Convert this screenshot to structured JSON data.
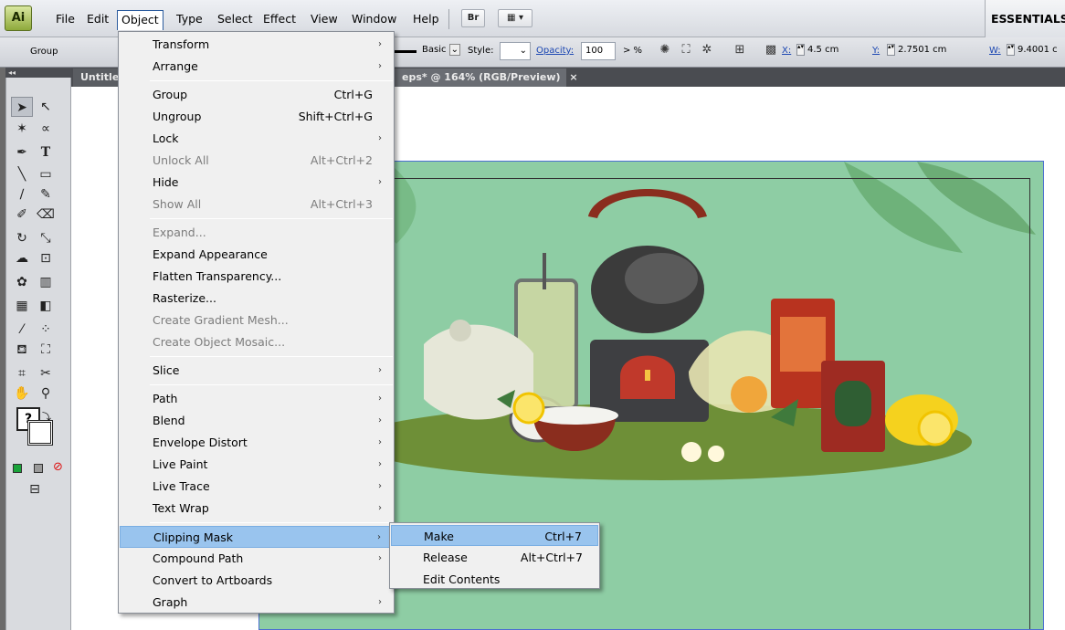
{
  "app": {
    "logo": "Ai"
  },
  "menubar": {
    "items": [
      "File",
      "Edit",
      "Object",
      "Type",
      "Select",
      "Effect",
      "View",
      "Window",
      "Help"
    ],
    "bridge_label": "Br",
    "workspace": "ESSENTIALS"
  },
  "control": {
    "selection": "Group",
    "stroke_profile": "Basic",
    "style_label": "Style:",
    "opacity_label": "Opacity:",
    "opacity_value": "100",
    "opacity_unit": "> %",
    "x_label": "X:",
    "x_value": "4.5 cm",
    "y_label": "Y:",
    "y_value": "2.7501 cm",
    "w_label": "W:",
    "w_value": "9.4001 c"
  },
  "document": {
    "tab_prefix": "Untitled",
    "tab_title": "eps* @ 164% (RGB/Preview)",
    "tab_close": "×"
  },
  "object_menu": [
    {
      "label": "Transform",
      "submenu": true
    },
    {
      "label": "Arrange",
      "submenu": true
    },
    {
      "sep": true
    },
    {
      "label": "Group",
      "shortcut": "Ctrl+G"
    },
    {
      "label": "Ungroup",
      "shortcut": "Shift+Ctrl+G"
    },
    {
      "label": "Lock",
      "submenu": true
    },
    {
      "label": "Unlock All",
      "shortcut": "Alt+Ctrl+2",
      "disabled": true
    },
    {
      "label": "Hide",
      "submenu": true
    },
    {
      "label": "Show All",
      "shortcut": "Alt+Ctrl+3",
      "disabled": true
    },
    {
      "sep": true
    },
    {
      "label": "Expand...",
      "disabled": true
    },
    {
      "label": "Expand Appearance"
    },
    {
      "label": "Flatten Transparency..."
    },
    {
      "label": "Rasterize..."
    },
    {
      "label": "Create Gradient Mesh...",
      "disabled": true
    },
    {
      "label": "Create Object Mosaic...",
      "disabled": true
    },
    {
      "sep": true
    },
    {
      "label": "Slice",
      "submenu": true
    },
    {
      "sep": true
    },
    {
      "label": "Path",
      "submenu": true
    },
    {
      "label": "Blend",
      "submenu": true
    },
    {
      "label": "Envelope Distort",
      "submenu": true
    },
    {
      "label": "Live Paint",
      "submenu": true
    },
    {
      "label": "Live Trace",
      "submenu": true
    },
    {
      "label": "Text Wrap",
      "submenu": true
    },
    {
      "sep": true
    },
    {
      "label": "Clipping Mask",
      "submenu": true,
      "highlighted": true
    },
    {
      "label": "Compound Path",
      "submenu": true
    },
    {
      "label": "Convert to Artboards"
    },
    {
      "label": "Graph",
      "submenu": true
    }
  ],
  "clipping_submenu": [
    {
      "label": "Make",
      "shortcut": "Ctrl+7",
      "highlighted": true
    },
    {
      "label": "Release",
      "shortcut": "Alt+Ctrl+7"
    },
    {
      "label": "Edit Contents"
    }
  ],
  "colors": {
    "artboard_bg": "#8ecda4",
    "menu_highlight": "#99c4ee",
    "selection": "#4c6fd1"
  }
}
